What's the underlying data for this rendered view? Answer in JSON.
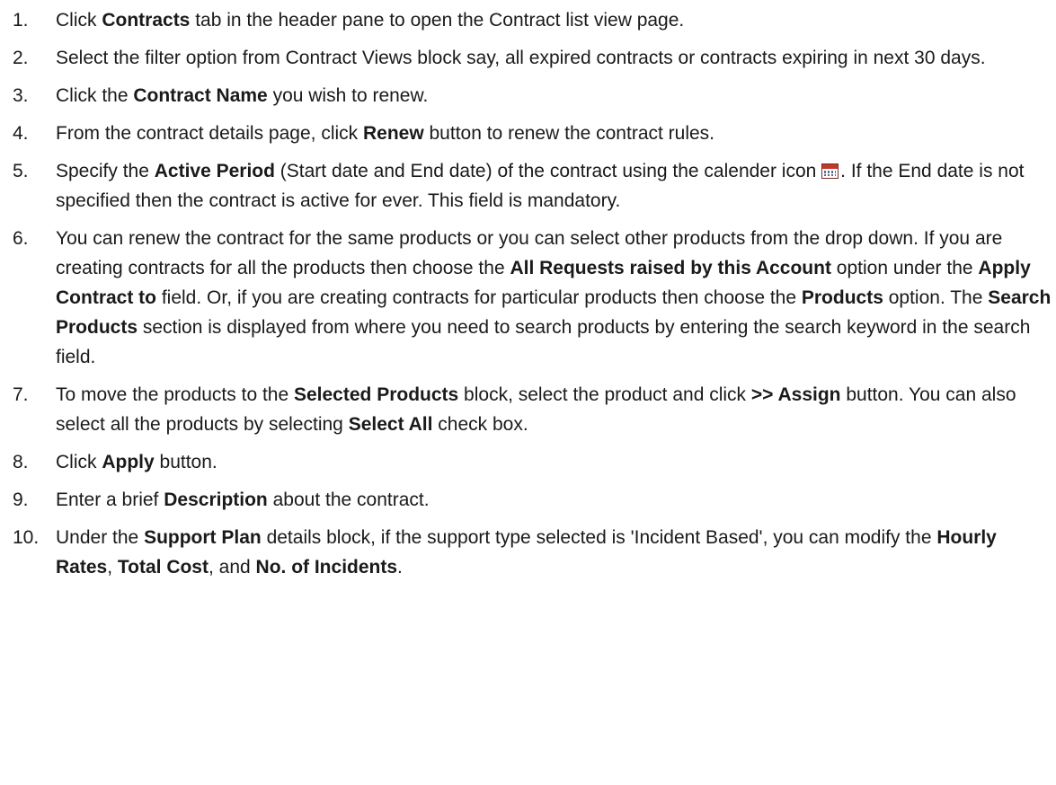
{
  "steps": [
    {
      "number": "1.",
      "segments": [
        {
          "t": "Click ",
          "b": false
        },
        {
          "t": "Contracts",
          "b": true
        },
        {
          "t": " tab in the header pane to open the Contract list view page.",
          "b": false
        }
      ]
    },
    {
      "number": "2.",
      "segments": [
        {
          "t": "Select the filter option from Contract Views block say, all expired contracts or contracts expiring in next 30 days.",
          "b": false
        }
      ]
    },
    {
      "number": "3.",
      "segments": [
        {
          "t": "Click the ",
          "b": false
        },
        {
          "t": "Contract Name",
          "b": true
        },
        {
          "t": " you wish to renew.",
          "b": false
        }
      ]
    },
    {
      "number": "4.",
      "segments": [
        {
          "t": "From the contract details page, click ",
          "b": false
        },
        {
          "t": "Renew",
          "b": true
        },
        {
          "t": " button to renew the contract rules.",
          "b": false
        }
      ]
    },
    {
      "number": "5.",
      "segments": [
        {
          "t": "Specify the ",
          "b": false
        },
        {
          "t": "Active Period",
          "b": true
        },
        {
          "t": " (Start date and End date) of the contract using the calender icon ",
          "b": false
        },
        {
          "icon": "calendar-icon"
        },
        {
          "t": ". If the End date is not specified then the contract is active for ever. This field is mandatory.",
          "b": false
        }
      ]
    },
    {
      "number": "6.",
      "segments": [
        {
          "t": "You can renew the contract for the same products or you can select other products from the drop down. If you are creating contracts for all the products then choose the ",
          "b": false
        },
        {
          "t": "All Requests raised by this Account",
          "b": true
        },
        {
          "t": " option under the ",
          "b": false
        },
        {
          "t": "Apply Contract to",
          "b": true
        },
        {
          "t": " field. Or, if you are creating contracts for particular products then choose the ",
          "b": false
        },
        {
          "t": "Products",
          "b": true
        },
        {
          "t": " option. The ",
          "b": false
        },
        {
          "t": "Search Products",
          "b": true
        },
        {
          "t": " section is displayed from where you need to search products by entering the search keyword in the search field.",
          "b": false
        }
      ]
    },
    {
      "number": "7.",
      "segments": [
        {
          "t": "To move the products to the ",
          "b": false
        },
        {
          "t": "Selected Products",
          "b": true
        },
        {
          "t": " block, select the product and click ",
          "b": false
        },
        {
          "t": ">> Assign",
          "b": true
        },
        {
          "t": " button. You can also select all the products by selecting ",
          "b": false
        },
        {
          "t": "Select All",
          "b": true
        },
        {
          "t": " check box.",
          "b": false
        }
      ]
    },
    {
      "number": "8.",
      "segments": [
        {
          "t": "Click ",
          "b": false
        },
        {
          "t": "Apply",
          "b": true
        },
        {
          "t": " button.",
          "b": false
        }
      ]
    },
    {
      "number": "9.",
      "segments": [
        {
          "t": "Enter a brief ",
          "b": false
        },
        {
          "t": "Description",
          "b": true
        },
        {
          "t": " about the contract.",
          "b": false
        }
      ]
    },
    {
      "number": "10.",
      "segments": [
        {
          "t": "Under the ",
          "b": false
        },
        {
          "t": "Support Plan",
          "b": true
        },
        {
          "t": " details block, if the support type selected is 'Incident Based', you can modify the ",
          "b": false
        },
        {
          "t": "Hourly Rates",
          "b": true
        },
        {
          "t": ", ",
          "b": false
        },
        {
          "t": "Total Cost",
          "b": true
        },
        {
          "t": ", and ",
          "b": false
        },
        {
          "t": "No. of Incidents",
          "b": true
        },
        {
          "t": ".",
          "b": false
        }
      ]
    }
  ]
}
